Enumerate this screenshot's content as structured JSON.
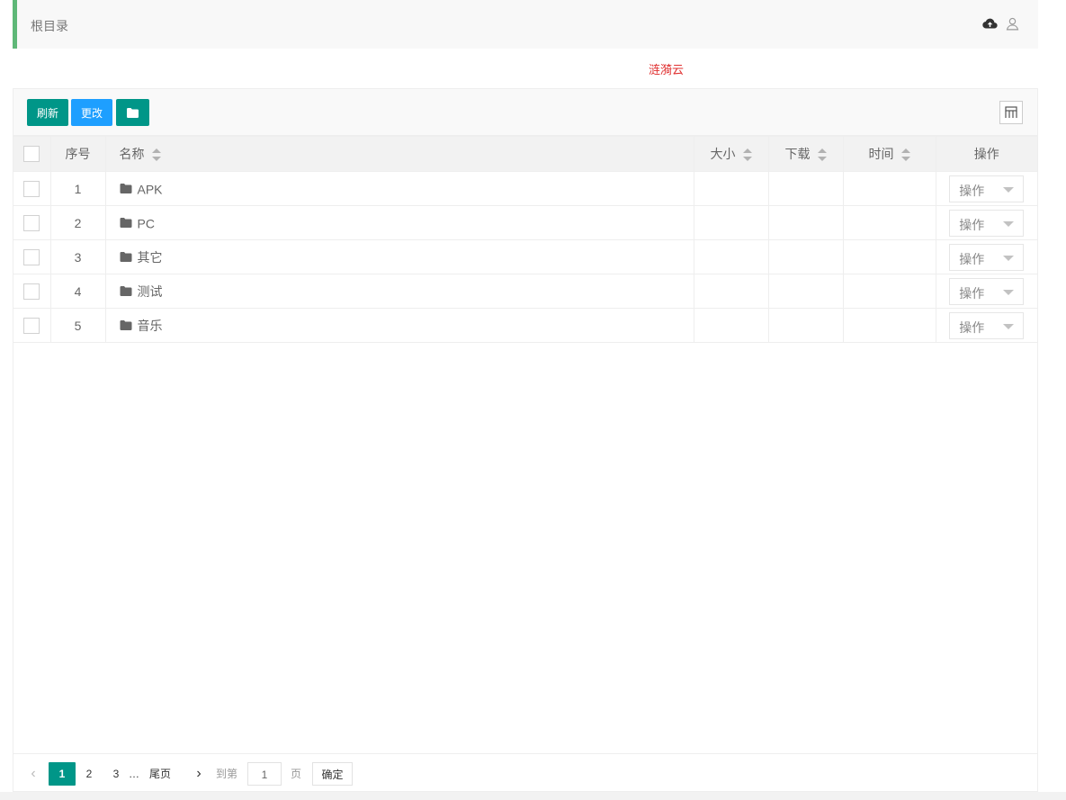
{
  "breadcrumb": {
    "current": "根目录"
  },
  "icons": {
    "upload": "cloud-upload-icon",
    "user": "user-icon",
    "folder": "folder-icon",
    "columns": "column-filter-icon"
  },
  "brand": {
    "text": "涟漪云",
    "color": "#e03030"
  },
  "toolbar": {
    "refresh_label": "刷新",
    "change_label": "更改"
  },
  "table": {
    "headers": {
      "index": "序号",
      "name": "名称",
      "size": "大小",
      "download": "下载",
      "time": "时间",
      "action": "操作"
    },
    "rows": [
      {
        "index": "1",
        "name": "APK",
        "size": "",
        "download": "",
        "time": "",
        "action": "操作"
      },
      {
        "index": "2",
        "name": "PC",
        "size": "",
        "download": "",
        "time": "",
        "action": "操作"
      },
      {
        "index": "3",
        "name": "其它",
        "size": "",
        "download": "",
        "time": "",
        "action": "操作"
      },
      {
        "index": "4",
        "name": "测试",
        "size": "",
        "download": "",
        "time": "",
        "action": "操作"
      },
      {
        "index": "5",
        "name": "音乐",
        "size": "",
        "download": "",
        "time": "",
        "action": "操作"
      }
    ]
  },
  "pagination": {
    "current": "1",
    "pages": [
      "2",
      "3"
    ],
    "ellipsis": "…",
    "last_label": "尾页",
    "goto_label": "到第",
    "goto_value": "1",
    "page_unit": "页",
    "confirm_label": "确定"
  },
  "colors": {
    "primary": "#009688",
    "info": "#1e9fff",
    "accent_bar": "#5fb878"
  }
}
